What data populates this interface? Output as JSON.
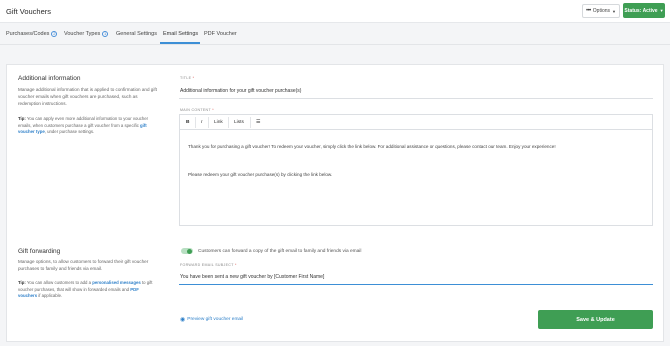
{
  "header": {
    "title": "Gift Vouchers",
    "options_label": "Options",
    "status_label": "Status: Active"
  },
  "tabs": [
    {
      "label": "Purchases/Codes",
      "badge": "2"
    },
    {
      "label": "Voucher Types",
      "badge": "1"
    },
    {
      "label": "General Settings",
      "badge": ""
    },
    {
      "label": "Email Settings",
      "badge": ""
    },
    {
      "label": "PDF Voucher",
      "badge": ""
    }
  ],
  "active_tab": "Email Settings",
  "additional": {
    "heading": "Additional information",
    "desc": "Manage additional information that is applied to confirmation and gift voucher emails when gift vouchers are purchased, such as redemption instructions.",
    "tip_label": "Tip:",
    "tip_text": "You can apply even more additional information to your voucher emails, when customers purchase a gift voucher from a specific",
    "tip_link": "gift voucher type",
    "tip_suffix": ", under purchase settings."
  },
  "title_field": {
    "label": "Title",
    "value": "Additional information for your gift voucher purchase(s)"
  },
  "main_content": {
    "label": "Main content",
    "toolbar": [
      "B",
      "I",
      "Link",
      "Lists",
      "☰"
    ],
    "para1": "Thank you for purchasing a gift voucher! To redeem your voucher, simply click the link below. For additional assistance or questions, please contact our team. Enjoy your experience!",
    "para2": "Please redeem your gift voucher purchase(s) by clicking the link below."
  },
  "forwarding": {
    "heading": "Gift forwarding",
    "desc": "Manage options, to allow customers to forward their gift voucher purchases to family and friends via email.",
    "tip_label": "Tip:",
    "tip_text1": "You can allow customers to add a",
    "tip_link1": "personalised messages",
    "tip_text2": "to gift voucher purchases, that will show in forwarded emails and",
    "tip_link2": "PDF vouchers",
    "tip_text3": "if applicable.",
    "toggle_label": "Customers can forward a copy of the gift email to family and friends via email",
    "toggle_on": true,
    "subject_label": "Forward email subject",
    "subject_value": "You have been sent a new gift voucher by [Customer First Name]"
  },
  "footer": {
    "preview_label": "Preview gift voucher email",
    "save_label": "Save & Update"
  },
  "colors": {
    "accent": "#3f9e54",
    "link": "#2f80c9",
    "tab_active": "#3d8fd6"
  }
}
